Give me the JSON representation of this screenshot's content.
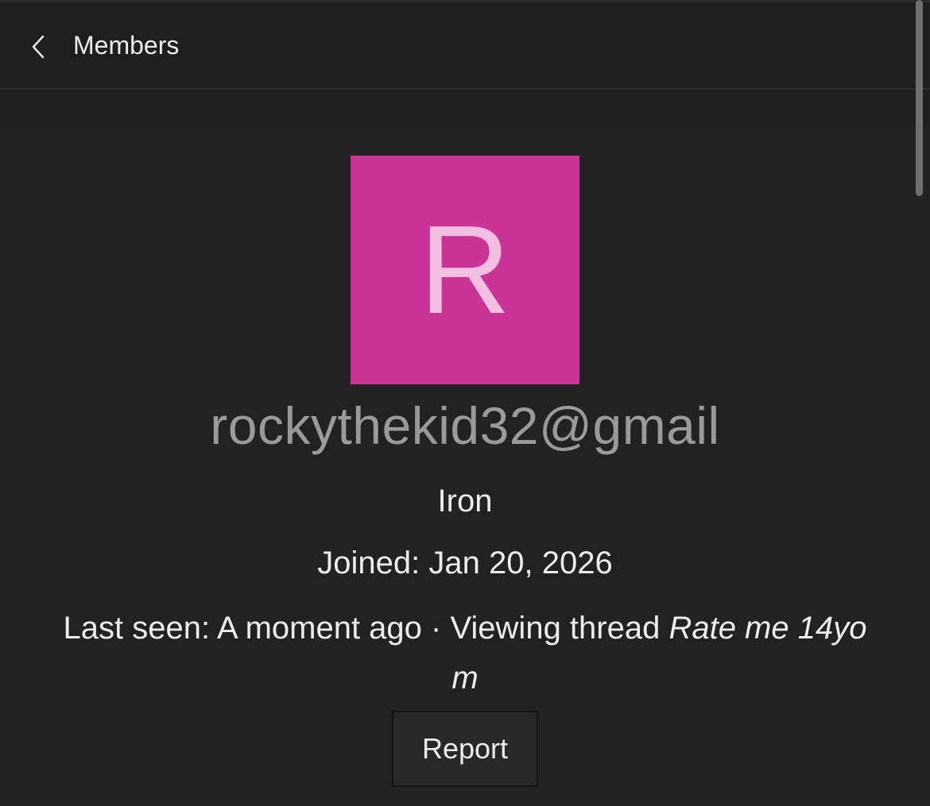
{
  "header": {
    "back_icon": "chevron-left-icon",
    "title": "Members"
  },
  "profile": {
    "avatar_letter": "R",
    "avatar_color": "#cb3497",
    "avatar_letter_color": "#f3c0e3",
    "username": "rockythekid32@gmail",
    "rank": "Iron",
    "joined": "Joined: Jan 20, 2026",
    "last_seen_prefix": "Last seen: A moment ago · Viewing thread ",
    "last_seen_thread": "Rate me 14yo m"
  },
  "actions": {
    "report_label": "Report"
  }
}
